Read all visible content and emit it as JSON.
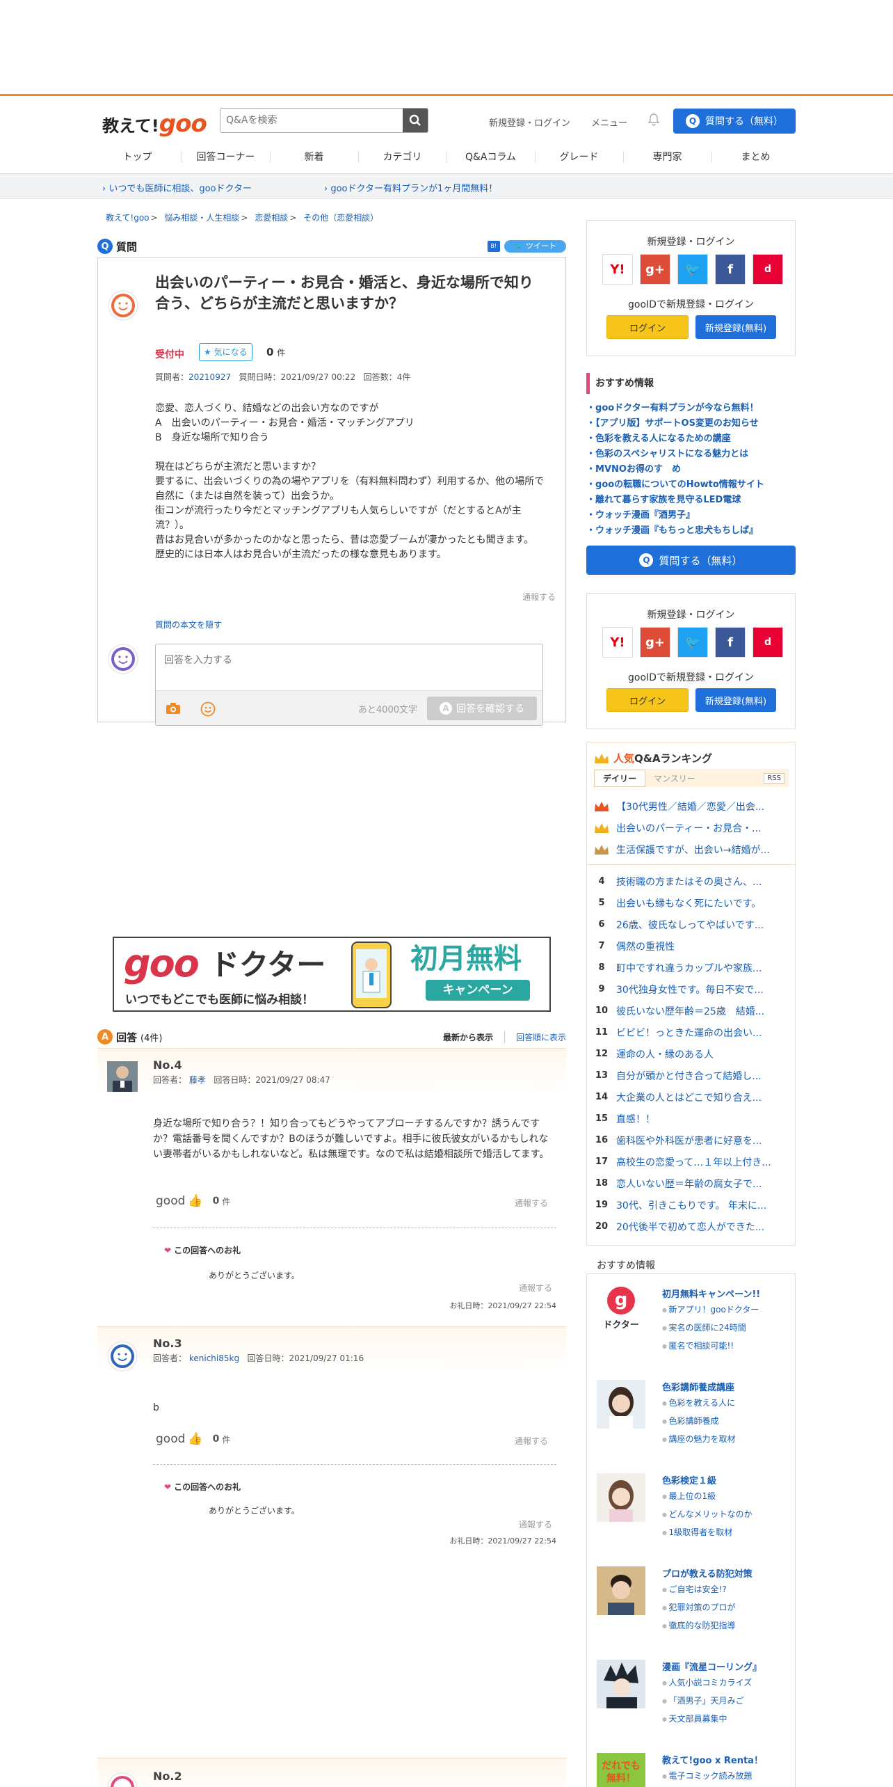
{
  "header": {
    "logo_text": "教えて!",
    "logo_goo": "goo",
    "search_placeholder": "Q&Aを検索",
    "register_login": "新規登録・ログイン",
    "menu": "メニュー",
    "ask_button": "質問する（無料）"
  },
  "nav": [
    "トップ",
    "回答コーナー",
    "新着",
    "カテゴリ",
    "Q&Aコラム",
    "グレード",
    "専門家",
    "まとめ"
  ],
  "subbar": {
    "left": "いつでも医師に相談、gooドクター",
    "right": "gooドクター有料プランが1ヶ月間無料！"
  },
  "breadcrumb": [
    "教えて!goo",
    "悩み相談・人生相談",
    "恋愛相談",
    "その他（恋愛相談）"
  ],
  "question": {
    "section_label": "質問",
    "tweet": "ツイート",
    "hatena": "B!",
    "title": "出会いのパーティー・お見合・婚活と、身近な場所で知り合う、どちらが主流だと思いますか？",
    "status": "受付中",
    "fav_label": "気になる",
    "fav_count": "0",
    "fav_unit": "件",
    "asker_label": "質問者：",
    "asker": "20210927",
    "date": "質問日時：2021/09/27 00:22",
    "answer_count": "回答数：4件",
    "body": "恋愛、恋人づくり、結婚などの出会い方なのですが\nA　出会いのパーティー・お見合・婚活・マッチングアプリ\nB　身近な場所で知り合う\n\n現在はどちらが主流だと思いますか？\n要するに、出会いづくりの為の場やアプリを（有料無料問わず）利用するか、他の場所で自然に（または自然を装って）出会うか。\n街コンが流行ったり今だとマッチングアプリも人気らしいですが（だとするとAが主流？）。\n昔はお見合いが多かったのかなと思ったら、昔は恋愛ブームが凄かったとも聞きます。\n歴史的には日本人はお見合いが主流だったの様な意見もあります。",
    "report": "通報する",
    "hide_body": "質問の本文を隠す",
    "answer_placeholder": "回答を入力する",
    "remaining": "あと4000文字",
    "confirm": "回答を確認する"
  },
  "banner": {
    "goo": "goo",
    "doctor": "ドクター",
    "tagline": "いつでもどこでも医師に悩み相談！",
    "free": "初月無料",
    "campaign": "キャンペーン"
  },
  "answers_header": {
    "label": "回答",
    "count": "(4件)",
    "sort_new": "最新から表示",
    "sort_old": "回答順に表示"
  },
  "answers": [
    {
      "no": "No.4",
      "answerer_label": "回答者：",
      "answerer": "藤孝",
      "date": "回答日時：2021/09/27 08:47",
      "body": "身近な場所で知り合う？！知り合ってもどうやってアプローチするんですか？誘うんですか？電話番号を聞くんですか？Bのほうが難しいですよ。相手に彼氏彼女がいるかもしれない妻帯者がいるかもしれないなど。私は無理です。なので私は結婚相談所で婚活してます。",
      "good": "good",
      "good_count": "0",
      "good_unit": "件",
      "report": "通報する",
      "thanks_title": "この回答へのお礼",
      "thanks_text": "ありがとうございます。",
      "thanks_report": "通報する",
      "thanks_date": "お礼日時：2021/09/27 22:54"
    },
    {
      "no": "No.3",
      "answerer_label": "回答者：",
      "answerer": "kenichi85kg",
      "date": "回答日時：2021/09/27 01:16",
      "body": "b",
      "good": "good",
      "good_count": "0",
      "good_unit": "件",
      "report": "通報する",
      "thanks_title": "この回答へのお礼",
      "thanks_text": "ありがとうございます。",
      "thanks_report": "通報する",
      "thanks_date": "お礼日時：2021/09/27 22:54"
    },
    {
      "no": "No.2"
    }
  ],
  "side": {
    "login_title": "新規登録・ログイン",
    "goo_id": "gooIDで新規登録・ログイン",
    "login": "ログイン",
    "register": "新規登録(無料)",
    "rec_title": "おすすめ情報",
    "rec_items": [
      "gooドクター有料プランが今なら無料！",
      "【アプリ版】サポートOS変更のお知らせ",
      "色彩を教える人になるための講座",
      "色彩のスペシャリストになる魅力とは",
      "MVNOお得のす　め",
      "gooの転職についてのHowto情報サイト",
      "離れて暮らす家族を見守るLED電球",
      "ウォッチ漫画『酒男子』",
      "ウォッチ漫画『もちっと忠犬もちしば』"
    ],
    "ask_button": "質問する（無料）",
    "ranking_hot": "人気",
    "ranking_title": "Q&Aランキング",
    "tab_daily": "デイリー",
    "tab_monthly": "マンスリー",
    "rss": "RSS",
    "ranking": [
      "【30代男性／結婚／恋愛／出会...",
      "出会いのパーティー・お見合・...",
      "生活保護ですが、出会い→結婚が...",
      "技術職の方またはその奥さん、...",
      "出会いも縁もなく死にたいです。",
      "26歳、彼氏なしってやばいです...",
      "偶然の重視性",
      "町中ですれ違うカップルや家族...",
      "30代独身女性です。毎日不安で...",
      "彼氏いない歴年齢＝25歳　結婚...",
      "ビビビ！っときた運命の出会い...",
      "運命の人・縁のある人",
      "自分が頭かと付き合って結婚し...",
      "大企業の人とはどこで知り合え...",
      "直感！！",
      "歯科医や外科医が患者に好意を...",
      "高校生の恋愛って…１年以上付き...",
      "恋人いない歴＝年齢の腐女子で...",
      "30代、引きこもりです。 年末に...",
      "20代後半で初めて恋人ができた..."
    ],
    "rank_numbers": [
      "4",
      "5",
      "6",
      "7",
      "8",
      "9",
      "10",
      "11",
      "12",
      "13",
      "14",
      "15",
      "16",
      "17",
      "18",
      "19",
      "20"
    ],
    "promo_head": "おすすめ情報",
    "promos": [
      {
        "title": "初月無料キャンペーン!!",
        "lines": [
          "新アプリ！gooドクター",
          "実名の医師に24時間",
          "匿名で相談可能!!"
        ],
        "img_text": "ドクター"
      },
      {
        "title": "色彩講師養成講座",
        "lines": [
          "色彩を教える人に",
          "色彩講師養成",
          "講座の魅力を取材"
        ]
      },
      {
        "title": "色彩検定１級",
        "lines": [
          "最上位の1級",
          "どんなメリットなのか",
          "1級取得者を取材"
        ]
      },
      {
        "title": "プロが教える防犯対策",
        "lines": [
          "ご自宅は安全!?",
          "犯罪対策のプロが",
          "徹底的な防犯指導"
        ]
      },
      {
        "title": "漫画『流星コーリング』",
        "lines": [
          "人気小説コミカライズ",
          "「酒男子」天月みご",
          "天文部員募集中"
        ]
      },
      {
        "title": "教えて!goo x Renta！",
        "lines": [
          "電子コミック読み放題"
        ],
        "img_text": "だれでも無料！"
      }
    ]
  }
}
